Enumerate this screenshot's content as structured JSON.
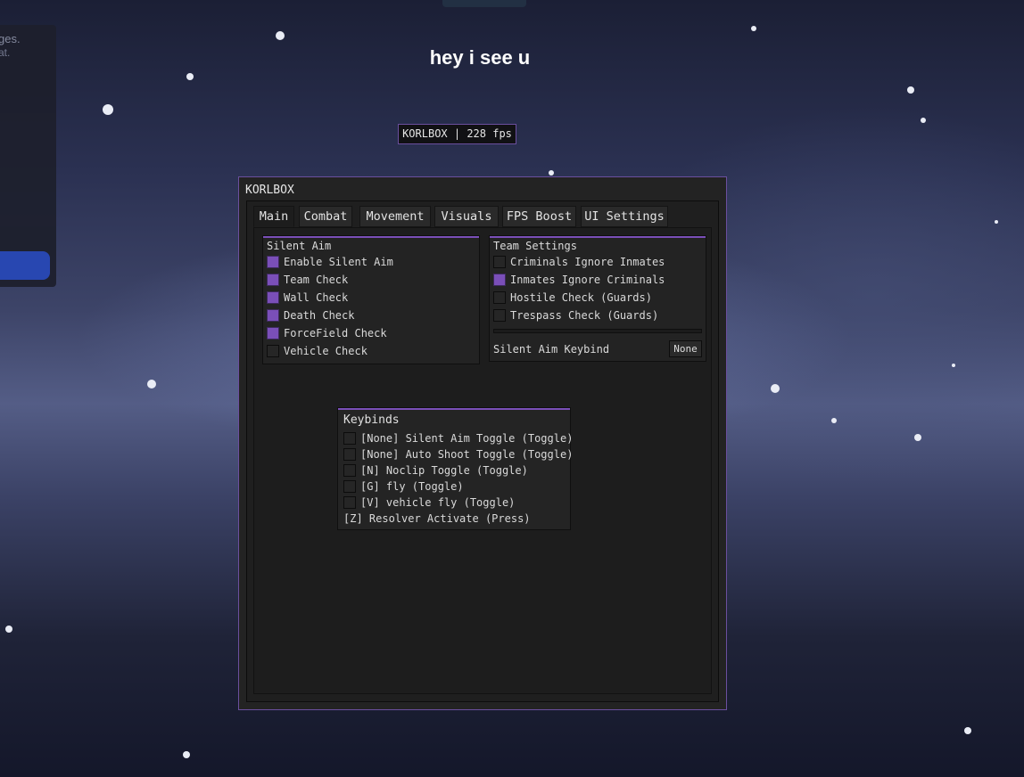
{
  "background": {
    "notice_line1": "ges.",
    "notice_line2": "at."
  },
  "chat_message": "hey i see u",
  "watermark": "KORLBOX | 228 fps",
  "window": {
    "title": "KORLBOX",
    "tabs": [
      {
        "label": "Main",
        "active": true
      },
      {
        "label": "Combat",
        "active": false
      },
      {
        "label": "Movement",
        "active": false
      },
      {
        "label": "Visuals",
        "active": false
      },
      {
        "label": "FPS Boost",
        "active": false
      },
      {
        "label": "UI Settings",
        "active": false
      }
    ],
    "silent_aim": {
      "title": "Silent Aim",
      "options": [
        {
          "label": "Enable Silent Aim",
          "checked": true
        },
        {
          "label": "Team Check",
          "checked": true
        },
        {
          "label": "Wall Check",
          "checked": true
        },
        {
          "label": "Death Check",
          "checked": true
        },
        {
          "label": "ForceField Check",
          "checked": true
        },
        {
          "label": "Vehicle Check",
          "checked": false
        }
      ]
    },
    "team_settings": {
      "title": "Team Settings",
      "options": [
        {
          "label": "Criminals Ignore Inmates",
          "checked": false
        },
        {
          "label": "Inmates Ignore Criminals",
          "checked": true
        },
        {
          "label": "Hostile Check (Guards)",
          "checked": false
        },
        {
          "label": "Trespass Check (Guards)",
          "checked": false
        }
      ],
      "keybind_label": "Silent Aim Keybind",
      "keybind_value": "None"
    }
  },
  "keybinds": {
    "title": "Keybinds",
    "items": [
      {
        "label": "[None] Silent Aim Toggle (Toggle)",
        "checked": false
      },
      {
        "label": "[None] Auto Shoot Toggle (Toggle)",
        "checked": false
      },
      {
        "label": "[N] Noclip Toggle (Toggle)",
        "checked": false
      },
      {
        "label": "[G] fly (Toggle)",
        "checked": false
      },
      {
        "label": "[V] vehicle fly (Toggle)",
        "checked": false
      }
    ],
    "press_item": "[Z] Resolver Activate (Press)"
  },
  "colors": {
    "accent": "#7a4fb8",
    "outline": "#6b4f9e"
  }
}
